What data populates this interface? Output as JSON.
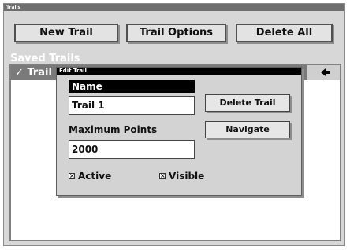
{
  "window": {
    "title": "Trails"
  },
  "toolbar": {
    "new_trail": "New Trail",
    "trail_options": "Trail Options",
    "delete_all": "Delete All"
  },
  "saved": {
    "label": "Saved Trails",
    "selected_item": "✓ Trail",
    "arrow": "◆"
  },
  "dialog": {
    "title": "Edit Trail",
    "name_label": "Name",
    "name_value": "Trail 1",
    "max_label": "Maximum Points",
    "max_value": "2000",
    "delete_button": "Delete Trail",
    "navigate_button": "Navigate",
    "active_label": "Active",
    "active_checked": true,
    "visible_label": "Visible",
    "visible_checked": true,
    "check_mark": "×"
  }
}
